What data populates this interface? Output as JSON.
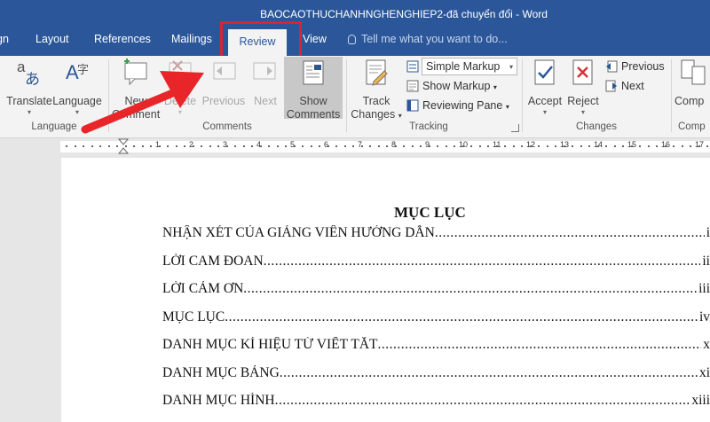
{
  "window": {
    "title": "BAOCAOTHUCHANHNGHENGHIEP2-đã chuyển đổi - Word"
  },
  "tabs": {
    "partial_design": "gn",
    "layout": "Layout",
    "references": "References",
    "mailings": "Mailings",
    "review": "Review",
    "view": "View",
    "tell_me": "Tell me what you want to do..."
  },
  "ribbon": {
    "language": {
      "translate": "Translate",
      "language": "Language",
      "group_label": "Language"
    },
    "comments": {
      "new_comment_line1": "New",
      "new_comment_line2": "Comment",
      "delete": "Delete",
      "previous": "Previous",
      "next": "Next",
      "show_comments_line1": "Show",
      "show_comments_line2": "Comments",
      "group_label": "Comments"
    },
    "tracking": {
      "track_changes_line1": "Track",
      "track_changes_line2": "Changes",
      "markup_select": "Simple Markup",
      "show_markup": "Show Markup",
      "reviewing_pane": "Reviewing Pane",
      "group_label": "Tracking"
    },
    "changes": {
      "accept": "Accept",
      "reject": "Reject",
      "previous": "Previous",
      "next": "Next",
      "group_label": "Changes"
    },
    "compare": {
      "label": "Comp",
      "group_label": "Comp"
    }
  },
  "ruler": {
    "numbers": [
      "1",
      "2",
      "3",
      "4",
      "5",
      "6",
      "7",
      "8",
      "9",
      "10",
      "11",
      "12",
      "13",
      "14",
      "15",
      "16",
      "17"
    ]
  },
  "document": {
    "heading": "MỤC LỤC",
    "toc": [
      {
        "title": "NHẬN XÉT CỦA GIẢNG VIÊN HƯỚNG DẪN",
        "page": "i"
      },
      {
        "title": "LỜI CAM ĐOAN",
        "page": "ii"
      },
      {
        "title": "LỜI CẢM ƠN",
        "page": "iii"
      },
      {
        "title": "MỤC LỤC",
        "page": "iv"
      },
      {
        "title": "DANH MỤC KÍ HIỆU TỪ VIẾT TẮT",
        "page": "x"
      },
      {
        "title": "DANH MỤC BẢNG",
        "page": "xi"
      },
      {
        "title": "DANH MỤC HÌNH",
        "page": "xiii"
      }
    ]
  },
  "colors": {
    "title_bar": "#2b579a",
    "ribbon": "#f3f3f3",
    "highlight": "#d9262c",
    "arrow": "#e8262a"
  },
  "icons": [
    "translate-icon",
    "language-icon",
    "new-comment-icon",
    "delete-comment-icon",
    "previous-comment-icon",
    "next-comment-icon",
    "show-comments-icon",
    "track-changes-icon",
    "show-markup-icon",
    "reviewing-pane-icon",
    "accept-icon",
    "reject-icon",
    "previous-change-icon",
    "next-change-icon",
    "lightbulb-icon"
  ]
}
